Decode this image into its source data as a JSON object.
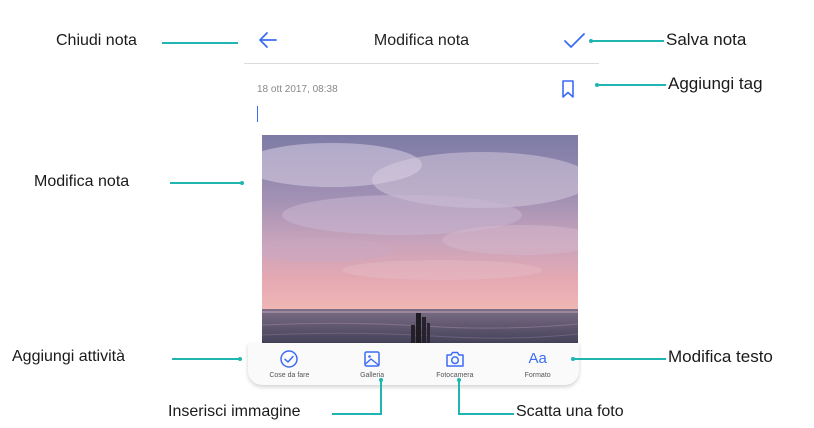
{
  "header": {
    "title": "Modifica nota",
    "back_icon": "arrow-left-icon",
    "save_icon": "checkmark-icon"
  },
  "note": {
    "timestamp": "18 ott 2017, 08:38",
    "tag_icon": "bookmark-icon",
    "image_description_icon": "photo-image"
  },
  "toolbar": {
    "items": [
      {
        "label": "Cose da fare",
        "icon": "check-circle-icon"
      },
      {
        "label": "Galleria",
        "icon": "gallery-icon"
      },
      {
        "label": "Fotocamera",
        "icon": "camera-icon"
      },
      {
        "label": "Formato",
        "icon": "text-format-icon",
        "glyph": "Aa"
      }
    ]
  },
  "callouts": {
    "close_note": "Chiudi nota",
    "save_note": "Salva nota",
    "add_tag": "Aggiungi tag",
    "edit_note": "Modifica nota",
    "add_activity": "Aggiungi attività",
    "edit_text": "Modifica testo",
    "insert_image": "Inserisci immagine",
    "take_photo": "Scatta una foto"
  },
  "colors": {
    "accent": "#3b6cf5",
    "leader": "#1fb6b2"
  }
}
